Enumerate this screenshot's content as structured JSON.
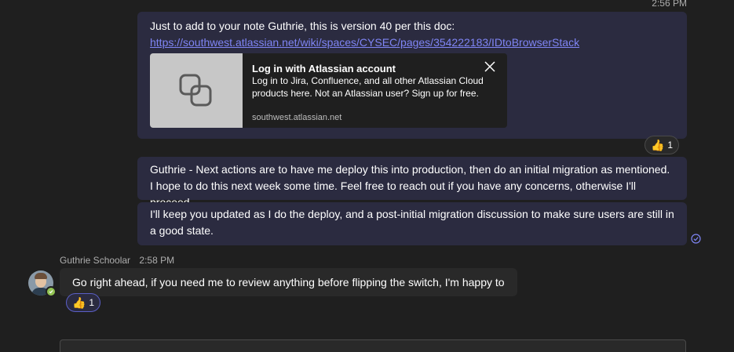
{
  "top": {
    "timestamp": "2:56 PM"
  },
  "messages": {
    "m1": {
      "text": "Just to add to your note Guthrie, this is version 40 per this doc:",
      "link": "https://southwest.atlassian.net/wiki/spaces/CYSEC/pages/354222183/IDtoBrowserStack"
    },
    "card": {
      "title": "Log in with Atlassian account",
      "description": "Log in to Jira, Confluence, and all other Atlassian Cloud products here. Not an Atlassian user? Sign up for free.",
      "domain": "southwest.atlassian.net",
      "thumb_icon": "link-icon",
      "close_icon": "close-icon"
    },
    "reaction1": {
      "emoji": "👍",
      "count": "1"
    },
    "m2": {
      "text": "Guthrie - Next actions are to have me deploy this into production, then do an initial migration as mentioned. I hope to do this next week some time. Feel free to reach out if you have any concerns, otherwise I'll proceed."
    },
    "m3": {
      "text": "I'll keep you updated as I do the deploy, and a post-initial migration discussion to make sure users are still in a good state."
    },
    "seen_icon": "seen-check-icon",
    "incoming": {
      "sender": "Guthrie Schoolar",
      "time": "2:58 PM",
      "text": "Go right ahead, if you need me to review anything before flipping the switch, I'm happy to",
      "presence": "available"
    },
    "reaction2": {
      "emoji": "👍",
      "count": "1"
    }
  },
  "colors": {
    "background": "#1f1f1f",
    "own_bubble": "#2b2b40",
    "other_bubble": "#292929",
    "link": "#7f85f5",
    "presence": "#92c353"
  }
}
